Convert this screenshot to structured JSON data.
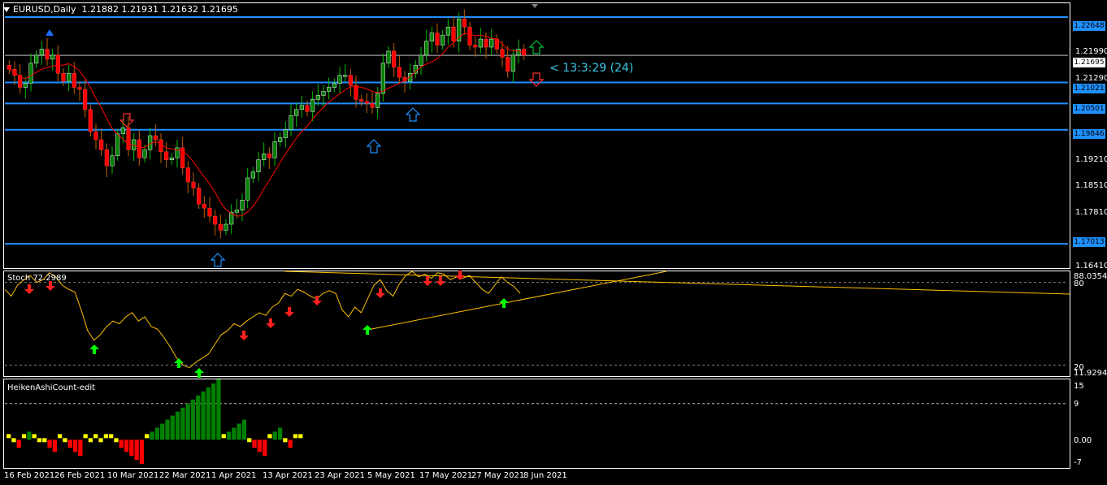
{
  "header": {
    "symbol_tf": "EURUSD,Daily",
    "ohlc": "1.21882 1.21931 1.21632 1.21695"
  },
  "countdown": "< 13:3:29 (24)",
  "price_axis": {
    "ticks": [
      "1.21990",
      "1.21290",
      "1.19210",
      "1.18510",
      "1.17810",
      "1.16410"
    ],
    "tags": [
      {
        "label": "1.22648",
        "kind": "level"
      },
      {
        "label": "1.21695",
        "kind": "current"
      },
      {
        "label": "1.21021",
        "kind": "level"
      },
      {
        "label": "1.20501",
        "kind": "level"
      },
      {
        "label": "1.19846",
        "kind": "level"
      },
      {
        "label": "1.17013",
        "kind": "level"
      }
    ]
  },
  "stoch": {
    "label": "Stoch 72.2989",
    "axis": {
      "top": "88.0354",
      "upper": "80",
      "lower": "20",
      "bottom": "11.9294"
    }
  },
  "heiken": {
    "label": "HeikenAshiCount-edit",
    "axis": {
      "top": "15",
      "mid": "9",
      "zero": "0.00",
      "bottom": "-7"
    }
  },
  "dates": [
    "16 Feb 2021",
    "26 Feb 2021",
    "10 Mar 2021",
    "22 Mar 2021",
    "1 Apr 2021",
    "13 Apr 2021",
    "23 Apr 2021",
    "5 May 2021",
    "17 May 2021",
    "27 May 2021",
    "8 Jun 2021"
  ],
  "colors": {
    "background": "#000000",
    "level_line": "#1e90ff",
    "bull_candle": "#008000",
    "bear_candle": "#ff0000",
    "ma_line": "#ff0000",
    "stoch_line": "#ffc000",
    "hist_up": "#008000",
    "hist_down": "#ff0000",
    "hist_neutral": "#ffff00"
  },
  "chart_data": [
    {
      "type": "candlestick",
      "title": "EURUSD,Daily",
      "ylim": [
        1.1641,
        1.2299
      ],
      "levels": [
        1.22648,
        1.21021,
        1.20501,
        1.19846,
        1.17013
      ],
      "current_price": 1.21695,
      "close": [
        1.2135,
        1.212,
        1.209,
        1.21,
        1.215,
        1.217,
        1.2185,
        1.216,
        1.217,
        1.2125,
        1.2105,
        1.2125,
        1.209,
        1.2085,
        1.2035,
        1.198,
        1.196,
        1.1935,
        1.1895,
        1.192,
        1.1975,
        1.199,
        1.1935,
        1.196,
        1.1915,
        1.1935,
        1.197,
        1.196,
        1.193,
        1.191,
        1.1915,
        1.194,
        1.189,
        1.1855,
        1.184,
        1.18,
        1.179,
        1.177,
        1.175,
        1.1735,
        1.175,
        1.178,
        1.1785,
        1.181,
        1.1865,
        1.188,
        1.191,
        1.1925,
        1.1915,
        1.1955,
        1.1965,
        1.1985,
        1.202,
        1.2035,
        1.2045,
        1.203,
        1.206,
        1.207,
        1.208,
        1.209,
        1.21,
        1.212,
        1.212,
        1.2095,
        1.206,
        1.2055,
        1.205,
        1.204,
        1.2075,
        1.215,
        1.218,
        1.214,
        1.2115,
        1.2105,
        1.2125,
        1.2145,
        1.217,
        1.2205,
        1.2225,
        1.2195,
        1.222,
        1.224,
        1.2205,
        1.226,
        1.224,
        1.2195,
        1.219,
        1.221,
        1.219,
        1.221,
        1.2185,
        1.2165,
        1.213,
        1.217,
        1.2185,
        1.217
      ]
    },
    {
      "type": "line",
      "title": "Stoch 72.2989",
      "ylim": [
        11.9294,
        88.0354
      ],
      "levels": [
        80,
        20
      ],
      "values": [
        75,
        70,
        78,
        82,
        85,
        80,
        82,
        87,
        84,
        78,
        75,
        73,
        60,
        45,
        38,
        42,
        48,
        52,
        50,
        55,
        58,
        52,
        55,
        48,
        46,
        40,
        33,
        25,
        20,
        18,
        22,
        25,
        28,
        35,
        42,
        45,
        50,
        48,
        52,
        55,
        58,
        56,
        62,
        65,
        72,
        70,
        75,
        73,
        70,
        68,
        72,
        74,
        72,
        60,
        55,
        62,
        58,
        68,
        78,
        82,
        74,
        70,
        79,
        85,
        88,
        84,
        86,
        83,
        87,
        86,
        82,
        84,
        83,
        85,
        80,
        75,
        72,
        78,
        84,
        80,
        77,
        72
      ]
    },
    {
      "type": "bar",
      "title": "HeikenAshiCount-edit",
      "ylim": [
        -7,
        15
      ],
      "values": [
        1,
        -1,
        -2,
        1,
        2,
        1,
        -1,
        -1,
        -2,
        -3,
        1,
        -1,
        -2,
        -3,
        -4,
        1,
        -1,
        1,
        -1,
        1,
        1,
        -1,
        -2,
        -3,
        -4,
        -5,
        -6,
        1,
        2,
        3,
        4,
        5,
        6,
        7,
        8,
        9,
        10,
        11,
        12,
        13,
        14,
        15,
        1,
        2,
        3,
        4,
        5,
        -1,
        -2,
        -3,
        -4,
        1,
        2,
        3,
        -1,
        -2,
        1,
        1
      ]
    }
  ]
}
